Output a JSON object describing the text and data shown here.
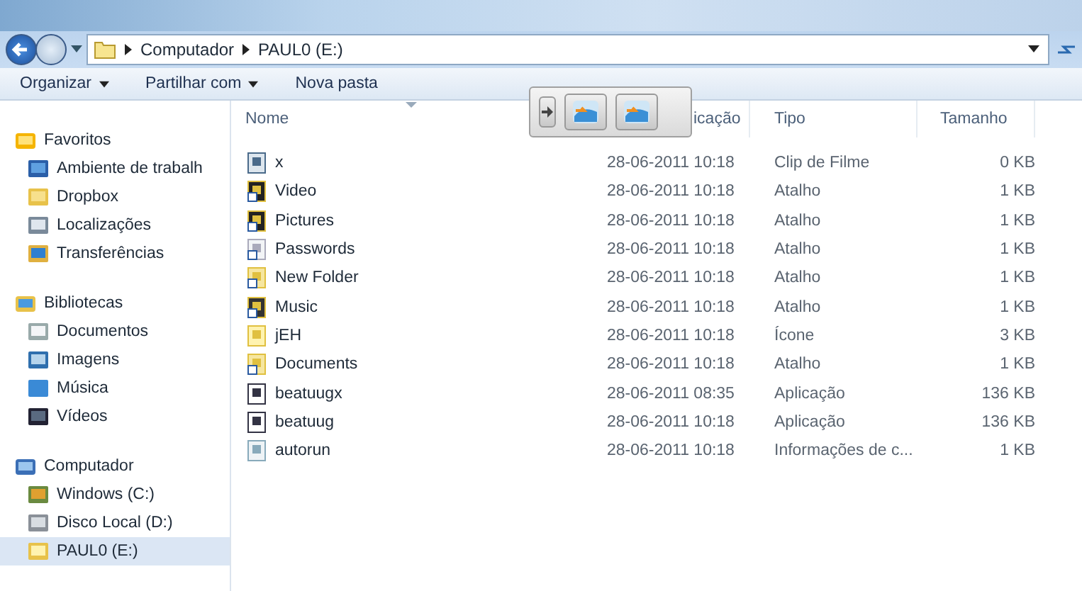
{
  "address_bar": {
    "path": [
      "Computador",
      "PAUL0 (E:)"
    ]
  },
  "toolbar": [
    {
      "label": "Organizar",
      "dropdown": true
    },
    {
      "label": "Partilhar com",
      "dropdown": true
    },
    {
      "label": "Nova pasta",
      "dropdown": false
    }
  ],
  "sidebar": [
    {
      "label": "Favoritos",
      "kind": "star",
      "items": [
        {
          "label": "Ambiente de trabalh",
          "kind": "desktop",
          "selected": false
        },
        {
          "label": "Dropbox",
          "kind": "folder",
          "selected": false
        },
        {
          "label": "Localizações",
          "kind": "places",
          "selected": false
        },
        {
          "label": "Transferências",
          "kind": "download",
          "selected": false
        }
      ]
    },
    {
      "label": "Bibliotecas",
      "kind": "library",
      "items": [
        {
          "label": "Documentos",
          "kind": "doc",
          "selected": false
        },
        {
          "label": "Imagens",
          "kind": "image",
          "selected": false
        },
        {
          "label": "Música",
          "kind": "music",
          "selected": false
        },
        {
          "label": "Vídeos",
          "kind": "film",
          "selected": false
        }
      ]
    },
    {
      "label": "Computador",
      "kind": "computer",
      "items": [
        {
          "label": "Windows (C:)",
          "kind": "windrive",
          "selected": false
        },
        {
          "label": "Disco Local (D:)",
          "kind": "drive",
          "selected": false
        },
        {
          "label": "PAUL0 (E:)",
          "kind": "openfolder",
          "selected": true
        }
      ]
    }
  ],
  "columns": [
    {
      "label": "Nome",
      "sorted": true
    },
    {
      "label": "icação",
      "sorted": false
    },
    {
      "label": "Tipo",
      "sorted": false
    },
    {
      "label": "Tamanho",
      "sorted": false
    }
  ],
  "files": [
    {
      "name": "x",
      "kind": "movie",
      "date": "28-06-2011 10:18",
      "type": "Clip de Filme",
      "size": "0 KB"
    },
    {
      "name": "Video",
      "kind": "media-shortcut",
      "date": "28-06-2011 10:18",
      "type": "Atalho",
      "size": "1 KB"
    },
    {
      "name": "Pictures",
      "kind": "media-shortcut",
      "date": "28-06-2011 10:18",
      "type": "Atalho",
      "size": "1 KB"
    },
    {
      "name": "Passwords",
      "kind": "file-shortcut",
      "date": "28-06-2011 10:18",
      "type": "Atalho",
      "size": "1 KB"
    },
    {
      "name": "New Folder",
      "kind": "folder-shortcut",
      "date": "28-06-2011 10:18",
      "type": "Atalho",
      "size": "1 KB"
    },
    {
      "name": "Music",
      "kind": "music-shortcut",
      "date": "28-06-2011 10:18",
      "type": "Atalho",
      "size": "1 KB"
    },
    {
      "name": "jEH",
      "kind": "folder",
      "date": "28-06-2011 10:18",
      "type": "Ícone",
      "size": "3 KB"
    },
    {
      "name": "Documents",
      "kind": "folder-shortcut",
      "date": "28-06-2011 10:18",
      "type": "Atalho",
      "size": "1 KB"
    },
    {
      "name": "beatuugx",
      "kind": "app",
      "date": "28-06-2011 08:35",
      "type": "Aplicação",
      "size": "136 KB"
    },
    {
      "name": "beatuug",
      "kind": "app",
      "date": "28-06-2011 10:18",
      "type": "Aplicação",
      "size": "136 KB"
    },
    {
      "name": "autorun",
      "kind": "config",
      "date": "28-06-2011 10:18",
      "type": "Informações de c...",
      "size": "1 KB"
    }
  ],
  "popup": {
    "buttons": [
      {
        "kind": "arrow"
      },
      {
        "kind": "image"
      },
      {
        "kind": "image"
      }
    ]
  }
}
